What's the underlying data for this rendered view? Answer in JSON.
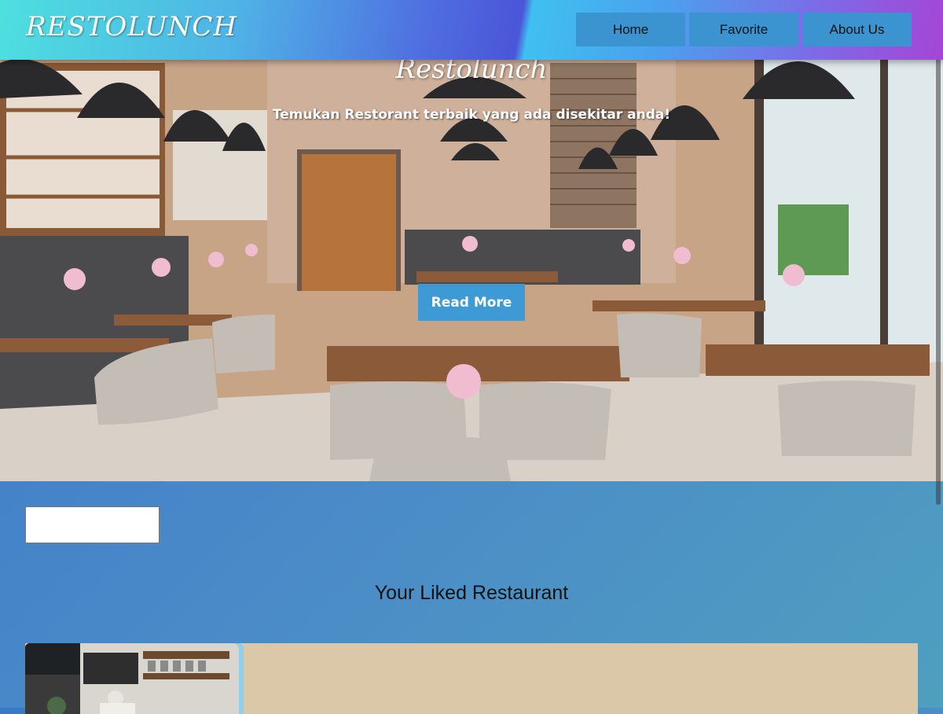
{
  "header": {
    "brand": "RESTOLUNCH",
    "nav": [
      "Home",
      "Favorite",
      "About Us"
    ]
  },
  "hero": {
    "title": "Restolunch",
    "subtitle": "Temukan Restorant terbaik yang ada disekitar anda!",
    "cta_label": "Read More"
  },
  "search": {
    "value": ""
  },
  "liked": {
    "title": "Your Liked Restaurant"
  },
  "colors": {
    "button": "#3d9ad4",
    "nav_button": "#3b93cf",
    "card_bg": "#dbc8a8"
  }
}
